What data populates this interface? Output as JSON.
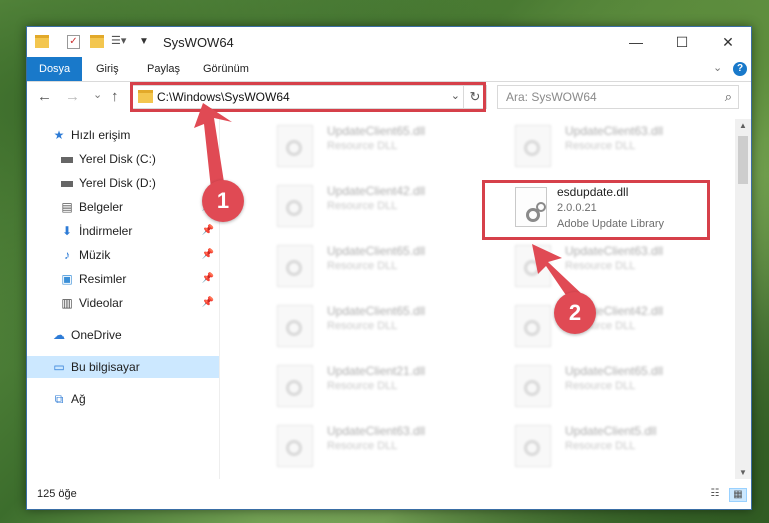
{
  "window": {
    "title": "SysWOW64",
    "controls": {
      "minimize": "—",
      "maximize": "☐",
      "close": "✕"
    }
  },
  "ribbon": {
    "tabs": [
      "Dosya",
      "Giriş",
      "Paylaş",
      "Görünüm"
    ],
    "help": "?"
  },
  "nav": {
    "back": "←",
    "forward": "→",
    "recent": "⌄",
    "up": "↑",
    "address": "C:\\Windows\\SysWOW64",
    "search_placeholder": "Ara: SysWOW64"
  },
  "sidebar": {
    "items": [
      {
        "label": "Hızlı erişim",
        "icon": "star-icon"
      },
      {
        "label": "Yerel Disk (C:)",
        "icon": "drive-icon"
      },
      {
        "label": "Yerel Disk (D:)",
        "icon": "drive-icon"
      },
      {
        "label": "Belgeler",
        "icon": "documents-icon"
      },
      {
        "label": "İndirmeler",
        "icon": "download-icon"
      },
      {
        "label": "Müzik",
        "icon": "music-icon"
      },
      {
        "label": "Resimler",
        "icon": "pictures-icon"
      },
      {
        "label": "Videolar",
        "icon": "video-icon"
      },
      {
        "label": "OneDrive",
        "icon": "cloud-icon"
      },
      {
        "label": "Bu bilgisayar",
        "icon": "computer-icon"
      },
      {
        "label": "Ağ",
        "icon": "network-icon"
      }
    ]
  },
  "files": {
    "left": [
      {
        "name": "UpdateClient65.dll",
        "desc": "Resource DLL"
      },
      {
        "name": "UpdateClient42.dll",
        "desc": "Resource DLL"
      },
      {
        "name": "UpdateClient65.dll",
        "desc": "Resource DLL"
      },
      {
        "name": "UpdateClient65.dll",
        "desc": "Resource DLL"
      },
      {
        "name": "UpdateClient21.dll",
        "desc": "Resource DLL"
      },
      {
        "name": "UpdateClient63.dll",
        "desc": "Resource DLL"
      }
    ],
    "right": [
      {
        "name": "UpdateClient63.dll",
        "desc": "Resource DLL"
      },
      {
        "name": "UpdateClient63.dll",
        "desc": "Resource DLL"
      },
      {
        "name": "UpdateClient42.dll",
        "desc": "Resource DLL"
      },
      {
        "name": "UpdateClient65.dll",
        "desc": "Resource DLL"
      },
      {
        "name": "UpdateClient5.dll",
        "desc": "Resource DLL"
      }
    ],
    "highlighted": {
      "name": "esdupdate.dll",
      "version": "2.0.0.21",
      "desc": "Adobe Update Library"
    }
  },
  "status": {
    "count": "125 öğe"
  },
  "annotations": {
    "badge1": "1",
    "badge2": "2",
    "color": "#d6404a"
  }
}
